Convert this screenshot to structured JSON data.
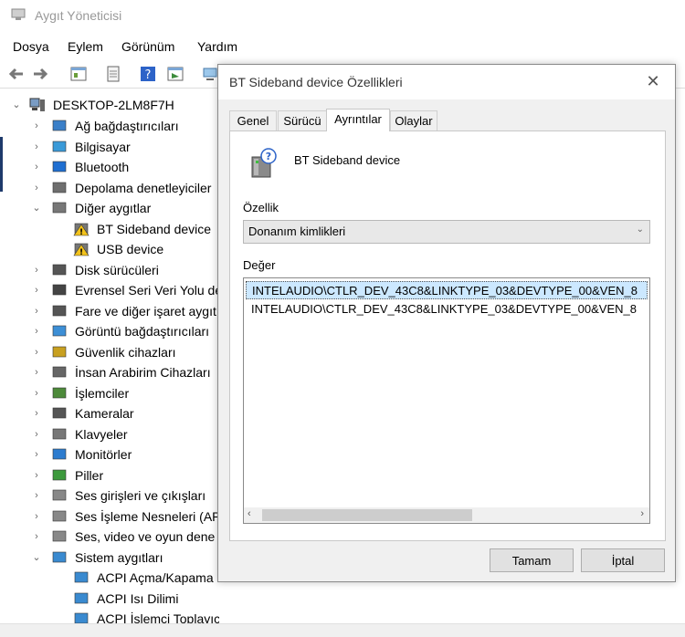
{
  "window": {
    "title": "Aygıt Yöneticisi"
  },
  "menu": [
    "Dosya",
    "Eylem",
    "Görünüm",
    "Yardım"
  ],
  "tree": {
    "root": "DESKTOP-2LM8F7H",
    "items": [
      {
        "label": "Ağ bağdaştırıcıları",
        "icon": "network-adapter-icon",
        "state": "collapsed"
      },
      {
        "label": "Bilgisayar",
        "icon": "computer-icon",
        "state": "collapsed"
      },
      {
        "label": "Bluetooth",
        "icon": "bluetooth-icon",
        "state": "collapsed"
      },
      {
        "label": "Depolama denetleyiciler",
        "icon": "storage-controller-icon",
        "state": "collapsed"
      },
      {
        "label": "Diğer aygıtlar",
        "icon": "other-devices-icon",
        "state": "expanded"
      },
      {
        "label": "BT Sideband device",
        "icon": "warning-device-icon",
        "state": "child"
      },
      {
        "label": "USB device",
        "icon": "warning-device-icon",
        "state": "child"
      },
      {
        "label": "Disk sürücüleri",
        "icon": "disk-drive-icon",
        "state": "collapsed"
      },
      {
        "label": "Evrensel Seri Veri Yolu de",
        "icon": "usb-icon",
        "state": "collapsed"
      },
      {
        "label": "Fare ve diğer işaret aygıt",
        "icon": "mouse-icon",
        "state": "collapsed"
      },
      {
        "label": "Görüntü bağdaştırıcıları",
        "icon": "display-adapter-icon",
        "state": "collapsed"
      },
      {
        "label": "Güvenlik cihazları",
        "icon": "security-device-icon",
        "state": "collapsed"
      },
      {
        "label": "İnsan Arabirim Cihazları",
        "icon": "hid-icon",
        "state": "collapsed"
      },
      {
        "label": "İşlemciler",
        "icon": "processor-icon",
        "state": "collapsed"
      },
      {
        "label": "Kameralar",
        "icon": "camera-icon",
        "state": "collapsed"
      },
      {
        "label": "Klavyeler",
        "icon": "keyboard-icon",
        "state": "collapsed"
      },
      {
        "label": "Monitörler",
        "icon": "monitor-icon",
        "state": "collapsed"
      },
      {
        "label": "Piller",
        "icon": "battery-icon",
        "state": "collapsed"
      },
      {
        "label": "Ses girişleri ve çıkışları",
        "icon": "speaker-icon",
        "state": "collapsed"
      },
      {
        "label": "Ses İşleme Nesneleri (AP",
        "icon": "speaker-icon",
        "state": "collapsed"
      },
      {
        "label": "Ses, video ve oyun dene",
        "icon": "speaker-icon",
        "state": "collapsed"
      },
      {
        "label": "Sistem aygıtları",
        "icon": "system-device-icon",
        "state": "expanded"
      },
      {
        "label": "ACPI Açma/Kapama Düğmesi",
        "icon": "system-device-icon",
        "state": "child"
      },
      {
        "label": "ACPI Isı Dilimi",
        "icon": "system-device-icon",
        "state": "child"
      },
      {
        "label": "ACPI İşlemci Toplayıcısı",
        "icon": "system-device-icon",
        "state": "child"
      }
    ]
  },
  "dialog": {
    "title": "BT Sideband device Özellikleri",
    "close_glyph": "✕",
    "tabs": [
      "Genel",
      "Sürücü",
      "Ayrıntılar",
      "Olaylar"
    ],
    "active_tab": "Ayrıntılar",
    "device_name": "BT Sideband device",
    "property_label": "Özellik",
    "property_value": "Donanım kimlikleri",
    "value_label": "Değer",
    "values": [
      "INTELAUDIO\\CTLR_DEV_43C8&LINKTYPE_03&DEVTYPE_00&VEN_8",
      "INTELAUDIO\\CTLR_DEV_43C8&LINKTYPE_03&DEVTYPE_00&VEN_8"
    ],
    "selected_value_index": 0,
    "ok_label": "Tamam",
    "cancel_label": "İptal"
  },
  "glyphs": {
    "chevron_right": "›",
    "chevron_down": "⌄",
    "scroll_left": "‹",
    "scroll_right": "›",
    "combo_arrow": "⌄"
  }
}
